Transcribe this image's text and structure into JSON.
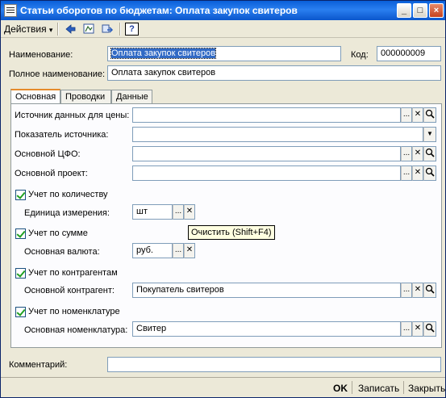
{
  "window": {
    "title": "Статьи оборотов по бюджетам: Оплата закупок свитеров",
    "min": "_",
    "max": "□",
    "close": "×"
  },
  "toolbar": {
    "actions_label": "Действия",
    "actions_arrow": "▾",
    "help_label": "?"
  },
  "header": {
    "name_label": "Наименование:",
    "name_value": "Оплата закупок свитеров",
    "code_label": "Код:",
    "code_value": "000000009",
    "fullname_label": "Полное наименование:",
    "fullname_value": "Оплата закупок свитеров"
  },
  "tabs": [
    {
      "label": "Основная"
    },
    {
      "label": "Проводки"
    },
    {
      "label": "Данные"
    }
  ],
  "form": {
    "price_source_label": "Источник данных для цены:",
    "price_source_value": "",
    "source_indicator_label": "Показатель источника:",
    "source_indicator_value": "",
    "cfo_label": "Основной ЦФО:",
    "cfo_value": "",
    "project_label": "Основной проект:",
    "project_value": "",
    "qty_check_label": "Учет по количеству",
    "unit_label": "Единица измерения:",
    "unit_value": "шт",
    "sum_check_label": "Учет по сумме",
    "currency_label": "Основная валюта:",
    "currency_value": "руб.",
    "contractor_check_label": "Учет по контрагентам",
    "contractor_label": "Основной контрагент:",
    "contractor_value": "Покупатель свитеров",
    "nomen_check_label": "Учет по номенклатуре",
    "nomen_label": "Основная номенклатура:",
    "nomen_value": "Свитер"
  },
  "tooltip": "Очистить (Shift+F4)",
  "comment": {
    "label": "Комментарий:",
    "value": ""
  },
  "footer": {
    "ok_label": "OK",
    "save_label": "Записать",
    "close_label": "Закрыть"
  },
  "buttons": {
    "select": "...",
    "clear": "✕",
    "open": "🔍",
    "dropdown": "▼"
  }
}
